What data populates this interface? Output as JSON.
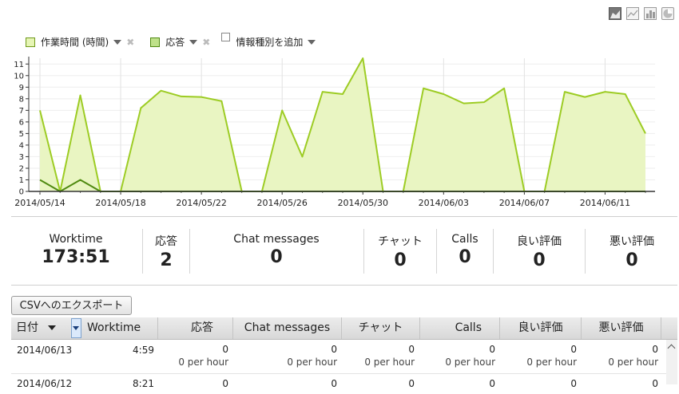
{
  "chart_controls": {
    "icons": [
      "area-chart-icon",
      "line-chart-icon",
      "bar-chart-icon",
      "pie-chart-icon"
    ]
  },
  "legend": {
    "series1": "作業時間 (時間)",
    "series2": "応答",
    "add_label": "情報種別を追加"
  },
  "colors": {
    "area_fill": "#e9f5c2",
    "line_main": "#9dcc24",
    "line_dark": "#4f8a10"
  },
  "chart_data": {
    "type": "area",
    "title": "",
    "xlabel": "",
    "ylabel": "",
    "x": [
      "2014/05/14",
      "2014/05/15",
      "2014/05/16",
      "2014/05/17",
      "2014/05/18",
      "2014/05/19",
      "2014/05/20",
      "2014/05/21",
      "2014/05/22",
      "2014/05/23",
      "2014/05/24",
      "2014/05/25",
      "2014/05/26",
      "2014/05/27",
      "2014/05/28",
      "2014/05/29",
      "2014/05/30",
      "2014/05/31",
      "2014/06/01",
      "2014/06/02",
      "2014/06/03",
      "2014/06/04",
      "2014/06/05",
      "2014/06/06",
      "2014/06/07",
      "2014/06/08",
      "2014/06/09",
      "2014/06/10",
      "2014/06/11",
      "2014/06/12",
      "2014/06/13"
    ],
    "x_ticks": [
      "2014/05/14",
      "2014/05/18",
      "2014/05/22",
      "2014/05/26",
      "2014/05/30",
      "2014/06/03",
      "2014/06/07",
      "2014/06/11"
    ],
    "y_ticks": [
      0,
      1,
      2,
      3,
      4,
      5,
      6,
      7,
      8,
      9,
      10,
      11
    ],
    "ylim": [
      0,
      11.5
    ],
    "grid": true,
    "legend_position": "top-left",
    "series": [
      {
        "name": "作業時間 (時間)",
        "values": [
          7.0,
          0,
          8.3,
          0,
          0,
          7.2,
          8.7,
          8.2,
          8.15,
          7.8,
          0,
          0,
          7.0,
          3.0,
          8.6,
          8.4,
          11.5,
          0,
          0,
          8.9,
          8.4,
          7.6,
          7.7,
          8.9,
          0,
          0,
          8.6,
          8.15,
          8.6,
          8.4,
          5.0
        ]
      },
      {
        "name": "応答",
        "values": [
          1,
          0,
          1,
          0,
          0,
          0,
          0,
          0,
          0,
          0,
          0,
          0,
          0,
          0,
          0,
          0,
          0,
          0,
          0,
          0,
          0,
          0,
          0,
          0,
          0,
          0,
          0,
          0,
          0,
          0,
          0
        ]
      }
    ]
  },
  "summary": [
    {
      "label": "Worktime",
      "value": "173:51"
    },
    {
      "label": "応答",
      "value": "2"
    },
    {
      "label": "Chat messages",
      "value": "0"
    },
    {
      "label": "チャット",
      "value": "0"
    },
    {
      "label": "Calls",
      "value": "0"
    },
    {
      "label": "良い評価",
      "value": "0"
    },
    {
      "label": "悪い評価",
      "value": "0"
    }
  ],
  "export_button": "CSVへのエクスポート",
  "table": {
    "columns": [
      "日付",
      "Worktime",
      "応答",
      "Chat messages",
      "チャット",
      "Calls",
      "良い評価",
      "悪い評価"
    ],
    "rows": [
      {
        "date": "2014/06/13",
        "worktime": "4:59",
        "cells": [
          {
            "v": "0",
            "s": "0 per hour"
          },
          {
            "v": "0",
            "s": "0 per hour"
          },
          {
            "v": "0",
            "s": "0 per hour"
          },
          {
            "v": "0",
            "s": "0 per hour"
          },
          {
            "v": "0",
            "s": "0 per hour"
          },
          {
            "v": "0",
            "s": "0 per hour"
          }
        ]
      },
      {
        "date": "2014/06/12",
        "worktime": "8:21",
        "cells": [
          {
            "v": "0"
          },
          {
            "v": "0"
          },
          {
            "v": "0"
          },
          {
            "v": "0"
          },
          {
            "v": "0"
          },
          {
            "v": "0"
          }
        ]
      }
    ]
  }
}
